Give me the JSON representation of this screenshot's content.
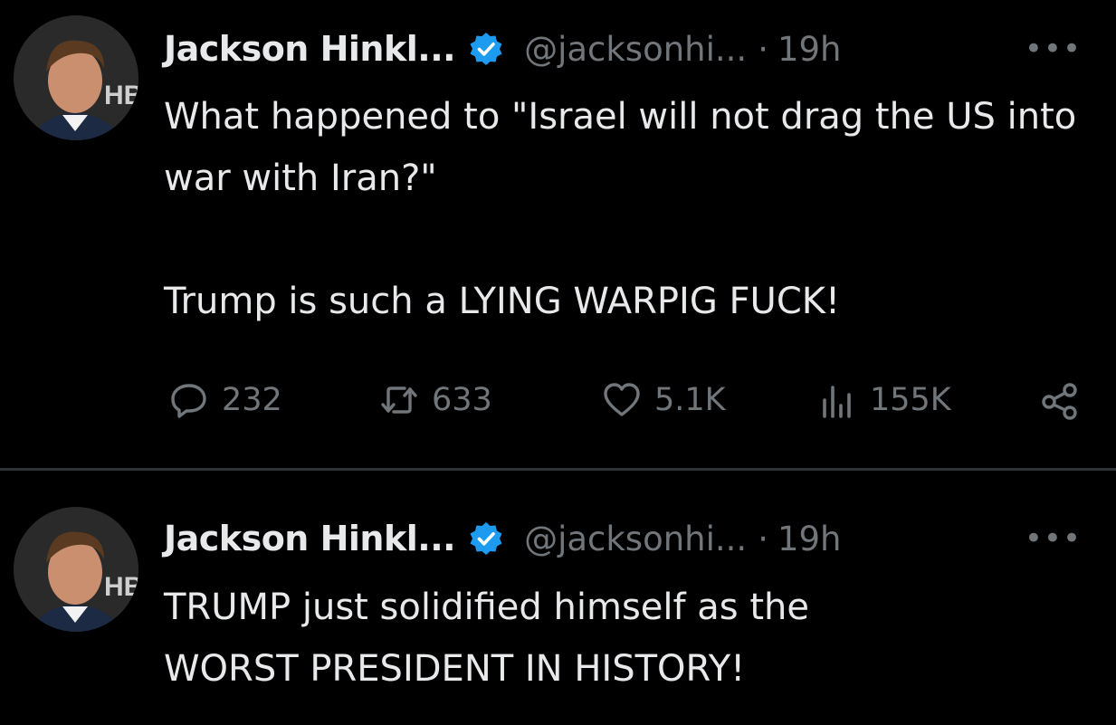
{
  "tweets": [
    {
      "author_name": "Jackson Hinkl...",
      "handle": "@jacksonhi...",
      "separator": "·",
      "time": "19h",
      "more_label": "•••",
      "text": "What happened to \"Israel will not drag the US into war with Iran?\"\n\nTrump is such a LYING WARPIG FUCK!",
      "stats": {
        "replies": "232",
        "reposts": "633",
        "likes": "5.1K",
        "views": "155K"
      }
    },
    {
      "author_name": "Jackson Hinkl...",
      "handle": "@jacksonhi...",
      "separator": "·",
      "time": "19h",
      "more_label": "•••",
      "text": "TRUMP just solidified himself as the WORST PRESIDENT IN HISTORY!"
    }
  ],
  "avatar_backdrop_text": "HB",
  "colors": {
    "background": "#000000",
    "text": "#e7e9ea",
    "muted": "#71767b",
    "verified": "#1d9bf0",
    "divider": "#2f3336"
  },
  "icons": [
    "verified-badge-icon",
    "more-icon",
    "reply-icon",
    "repost-icon",
    "like-icon",
    "views-icon",
    "share-icon"
  ]
}
